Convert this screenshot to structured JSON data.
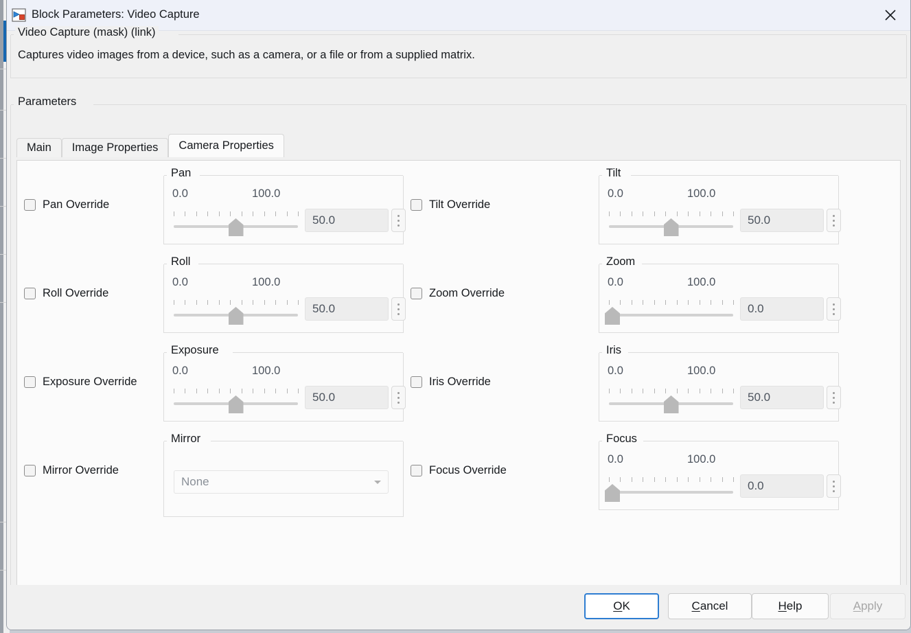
{
  "window": {
    "title": "Block Parameters: Video Capture",
    "icon": "simulink-block-icon",
    "close_label": "✕"
  },
  "header": {
    "mask_title": "Video Capture (mask) (link)",
    "description": "Captures video images from a device, such as a camera, or a file or from a supplied matrix."
  },
  "parameters": {
    "group_title": "Parameters",
    "tabs": [
      {
        "label": "Main",
        "active": false
      },
      {
        "label": "Image Properties",
        "active": false
      },
      {
        "label": "Camera Properties",
        "active": true
      }
    ]
  },
  "left_column": [
    {
      "checkbox_label": "Pan Override",
      "checked": false,
      "group_title": "Pan",
      "min": "0.0",
      "max": "100.0",
      "value": "50.0",
      "percent": 50
    },
    {
      "checkbox_label": "Roll Override",
      "checked": false,
      "group_title": "Roll",
      "min": "0.0",
      "max": "100.0",
      "value": "50.0",
      "percent": 50
    },
    {
      "checkbox_label": "Exposure Override",
      "checked": false,
      "group_title": "Exposure",
      "min": "0.0",
      "max": "100.0",
      "value": "50.0",
      "percent": 50
    }
  ],
  "left_mirror": {
    "checkbox_label": "Mirror Override",
    "checked": false,
    "group_title": "Mirror",
    "value": "None",
    "options": [
      "None"
    ]
  },
  "right_column": [
    {
      "checkbox_label": "Tilt Override",
      "checked": false,
      "group_title": "Tilt",
      "min": "0.0",
      "max": "100.0",
      "value": "50.0",
      "percent": 50
    },
    {
      "checkbox_label": "Zoom Override",
      "checked": false,
      "group_title": "Zoom",
      "min": "0.0",
      "max": "100.0",
      "value": "0.0",
      "percent": 0
    },
    {
      "checkbox_label": "Iris Override",
      "checked": false,
      "group_title": "Iris",
      "min": "0.0",
      "max": "100.0",
      "value": "50.0",
      "percent": 50
    },
    {
      "checkbox_label": "Focus Override",
      "checked": false,
      "group_title": "Focus",
      "min": "0.0",
      "max": "100.0",
      "value": "0.0",
      "percent": 0
    }
  ],
  "footer": {
    "ok": {
      "pre": "",
      "mnemonic": "O",
      "post": "K",
      "state": "default-focused"
    },
    "cancel": {
      "pre": "",
      "mnemonic": "C",
      "post": "ancel",
      "state": "normal"
    },
    "help": {
      "pre": "",
      "mnemonic": "H",
      "post": "elp",
      "state": "normal"
    },
    "apply": {
      "pre": "",
      "mnemonic": "A",
      "post": "pply",
      "state": "disabled"
    }
  },
  "colors": {
    "titlebar": "#eef1f9",
    "dialog_bg": "#f0f0f0",
    "panel_bg": "#fbfbfb",
    "focus_blue": "#2d7dd2",
    "text": "#16191d",
    "muted_text": "#4d545e"
  }
}
